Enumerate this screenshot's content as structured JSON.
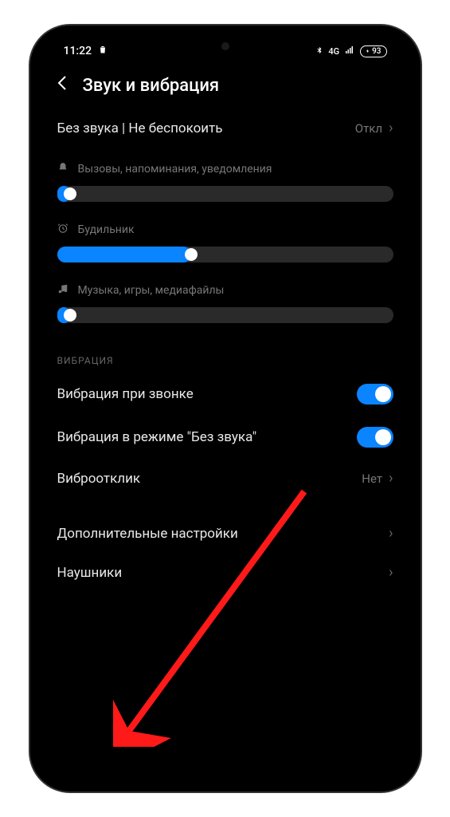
{
  "status_bar": {
    "time": "11:22",
    "network_label": "4G",
    "battery": "93"
  },
  "header": {
    "title": "Звук и вибрация"
  },
  "dnd": {
    "label": "Без звука | Не беспокоить",
    "value": "Откл"
  },
  "sliders": {
    "ring": {
      "label": "Вызовы, напоминания, уведомления",
      "percent": 4
    },
    "alarm": {
      "label": "Будильник",
      "percent": 40
    },
    "media": {
      "label": "Музыка, игры, медиафайлы",
      "percent": 4
    }
  },
  "vibration_section": {
    "header": "ВИБРАЦИЯ",
    "vibrate_on_call": {
      "label": "Вибрация при звонке",
      "enabled": true
    },
    "vibrate_silent": {
      "label": "Вибрация в режиме \"Без звука\"",
      "enabled": true
    },
    "haptic": {
      "label": "Виброотклик",
      "value": "Нет"
    }
  },
  "extra": {
    "additional": {
      "label": "Дополнительные настройки"
    },
    "headphones": {
      "label": "Наушники"
    }
  }
}
